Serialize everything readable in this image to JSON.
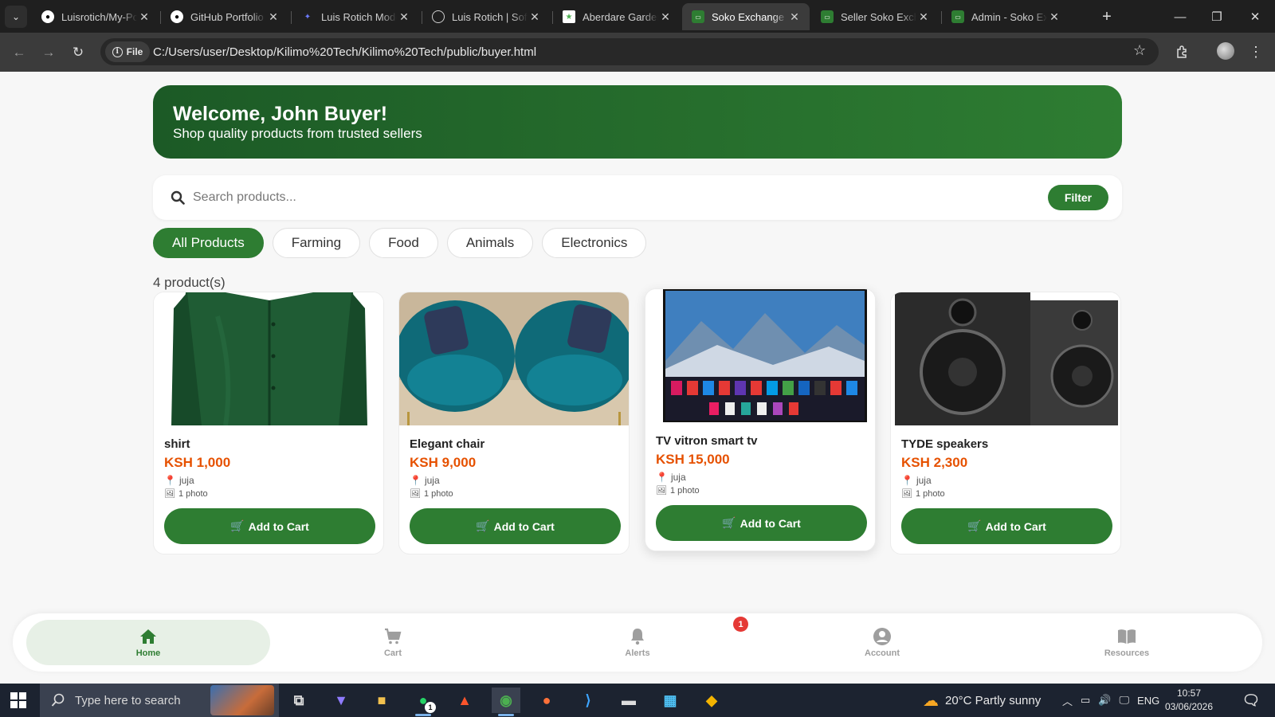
{
  "browser": {
    "tabs": [
      {
        "label": "Luisrotich/My-Portfolio",
        "icon": "github-icon"
      },
      {
        "label": "GitHub Portfolio",
        "icon": "github-icon"
      },
      {
        "label": "Luis Rotich Modern Portfolio",
        "icon": "portfolio-icon"
      },
      {
        "label": "Luis Rotich | Software Engineer",
        "icon": "globe-icon"
      },
      {
        "label": "Aberdare Gardens",
        "icon": "site-icon"
      },
      {
        "label": "Soko Exchange",
        "icon": "soko-icon",
        "active": true
      },
      {
        "label": "Seller Soko Exchange",
        "icon": "soko-icon"
      },
      {
        "label": "Admin - Soko Exchange",
        "icon": "soko-icon"
      }
    ],
    "new_tab": "+",
    "file_chip": "File",
    "url": "C:/Users/user/Desktop/Kilimo%20Tech/Kilimo%20Tech/public/buyer.html"
  },
  "banner": {
    "title": "Welcome, John Buyer!",
    "subtitle": "Shop quality products from trusted sellers"
  },
  "search": {
    "placeholder": "Search products...",
    "filter_label": "Filter"
  },
  "categories": [
    {
      "label": "All Products",
      "active": true
    },
    {
      "label": "Farming"
    },
    {
      "label": "Food"
    },
    {
      "label": "Animals"
    },
    {
      "label": "Electronics"
    }
  ],
  "product_count": "4 product(s)",
  "products": [
    {
      "name": "shirt",
      "price": "KSH 1,000",
      "location": "juja",
      "photos": "1 photo",
      "button": "Add to Cart"
    },
    {
      "name": "Elegant chair",
      "price": "KSH 9,000",
      "location": "juja",
      "photos": "1 photo",
      "button": "Add to Cart"
    },
    {
      "name": "TV vitron smart tv",
      "price": "KSH 15,000",
      "location": "juja",
      "photos": "1 photo",
      "button": "Add to Cart"
    },
    {
      "name": "TYDE speakers",
      "price": "KSH 2,300",
      "location": "juja",
      "photos": "1 photo",
      "button": "Add to Cart"
    }
  ],
  "bottom_nav": {
    "items": [
      {
        "label": "Home",
        "icon": "home-icon",
        "active": true
      },
      {
        "label": "Cart",
        "icon": "cart-icon"
      },
      {
        "label": "Alerts",
        "icon": "bell-icon"
      },
      {
        "label": "Account",
        "icon": "account-icon"
      },
      {
        "label": "Resources",
        "icon": "book-icon"
      }
    ],
    "alerts_badge": "1"
  },
  "taskbar": {
    "search_placeholder": "Type here to search",
    "whatsapp_badge": "1",
    "weather": "20°C  Partly sunny",
    "language": "ENG",
    "time": "10:57",
    "date": "03/06/2026"
  },
  "colors": {
    "brand_green": "#2e7d32",
    "price_orange": "#e65100",
    "badge_red": "#e53935"
  }
}
